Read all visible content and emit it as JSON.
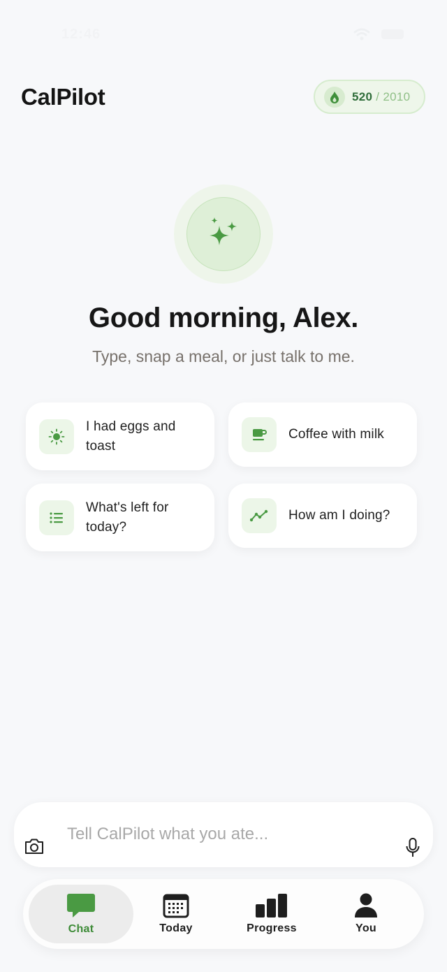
{
  "status_bar": {
    "time": "12:46"
  },
  "header": {
    "app_title": "CalPilot",
    "calories": {
      "consumed": "520",
      "separator": "/",
      "goal": "2010"
    }
  },
  "hero": {
    "icon": "sparkles-icon",
    "greeting": "Good morning, Alex.",
    "subtitle": "Type, snap a meal, or just talk to me."
  },
  "suggestions": [
    {
      "icon": "sun-icon",
      "label": "I had eggs and toast"
    },
    {
      "icon": "coffee-cup-icon",
      "label": "Coffee with milk"
    },
    {
      "icon": "list-icon",
      "label": "What's left for today?"
    },
    {
      "icon": "trend-icon",
      "label": "How am I doing?"
    }
  ],
  "chat_input": {
    "placeholder": "Tell CalPilot what you ate...",
    "left_icon": "camera-icon",
    "right_icon": "microphone-icon"
  },
  "tabs": [
    {
      "label": "Chat",
      "icon": "chat-bubble-icon",
      "active": true
    },
    {
      "label": "Today",
      "icon": "calendar-icon",
      "active": false
    },
    {
      "label": "Progress",
      "icon": "bar-chart-icon",
      "active": false
    },
    {
      "label": "You",
      "icon": "person-icon",
      "active": false
    }
  ],
  "colors": {
    "accent": "#4a9a43",
    "accent_light": "#ecf6e8",
    "background": "#f7f8fa",
    "text_primary": "#161616",
    "text_secondary": "#77716b"
  }
}
